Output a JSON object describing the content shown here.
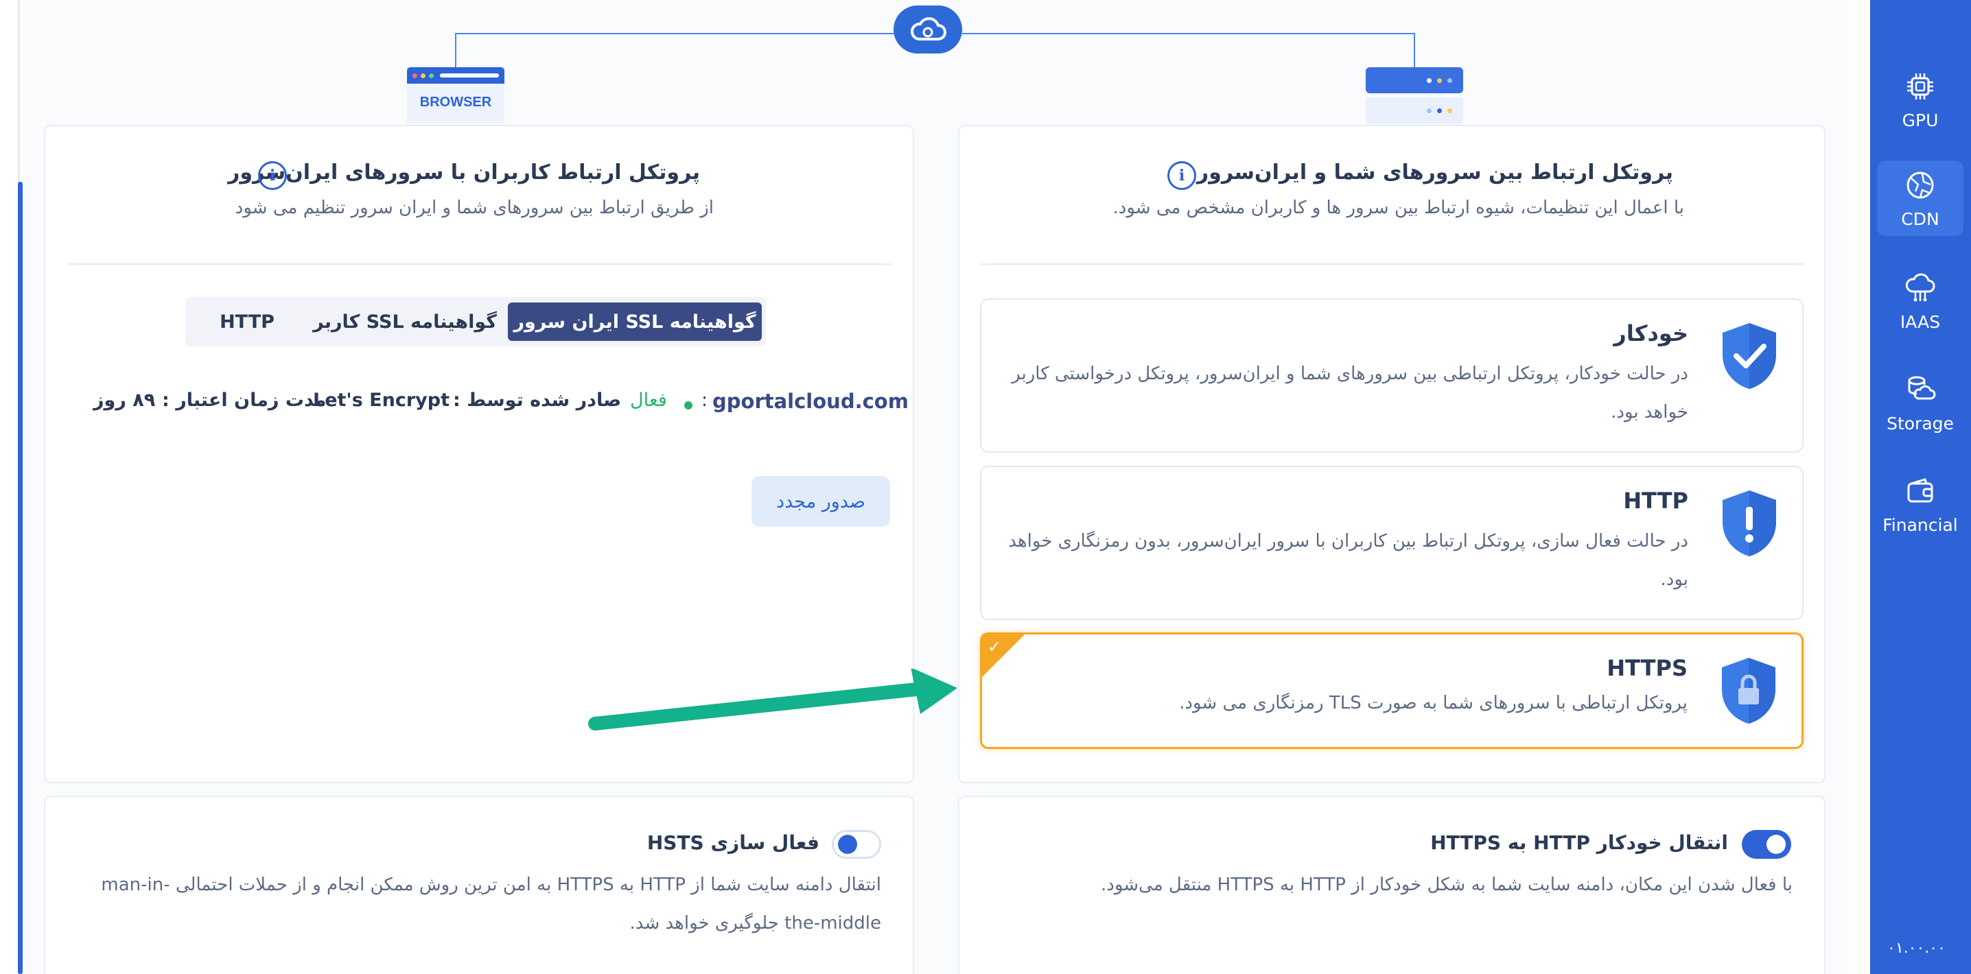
{
  "sidebar": {
    "items": [
      {
        "label": "GPU",
        "icon": "chip-icon"
      },
      {
        "label": "CDN",
        "icon": "globe-icon"
      },
      {
        "label": "IAAS",
        "icon": "cloud-network-icon"
      },
      {
        "label": "Storage",
        "icon": "storage-icon"
      },
      {
        "label": "Financial",
        "icon": "wallet-icon"
      }
    ],
    "active": "CDN",
    "version": "۰۱.۰۰.۰۰"
  },
  "diagram": {
    "browser_label": "BROWSER"
  },
  "user_protocol": {
    "title": "پروتکل ارتباط کاربران با سرورهای ایران‌سرور",
    "subtitle": "از طریق ارتباط بین سرورهای شما و ایران سرور تنظیم می شود",
    "tabs": [
      "گواهینامه SSL ایران سرور",
      "گواهینامه SSL کاربر",
      "HTTP"
    ],
    "active_tab": "گواهینامه SSL ایران سرور",
    "domain": "gportalcloud.com",
    "domain_sep": ":",
    "status": "فعال",
    "issuer_label": "صادر شده توسط :",
    "issuer": "Let's Encrypt",
    "validity_label": "مدت زمان اعتبار :",
    "validity": "۸۹ روز",
    "renew_button": "صدور مجدد"
  },
  "server_protocol": {
    "title": "پروتکل ارتباط بین سرورهای شما و ایران‌سرور",
    "subtitle": "با اعمال این تنظیمات، شیوه ارتباط بین سرور ها و کاربران مشخص می شود.",
    "options": [
      {
        "title": "خودکار",
        "desc": "در حالت خودکار، پروتکل ارتباطی بین سرورهای شما و ایران‌سرور، پروتکل درخواستی کاربر خواهد بود.",
        "icon": "shield-check-icon",
        "selected": false
      },
      {
        "title": "HTTP",
        "desc": "در حالت فعال سازی، پروتکل ارتباط بین کاربران با سرور ایران‌سرور، بدون رمزنگاری خواهد بود.",
        "icon": "shield-alert-icon",
        "selected": false
      },
      {
        "title": "HTTPS",
        "desc": "پروتکل ارتباطی با سرورهای شما به صورت TLS رمزنگاری می شود.",
        "icon": "shield-lock-icon",
        "selected": true
      }
    ]
  },
  "hsts": {
    "title": "فعال سازی HSTS",
    "desc": "انتقال دامنه سایت شما از HTTP به HTTPS به امن ترین روش ممکن انجام و از حملات احتمالی man-in-the-middle جلوگیری خواهد شد.",
    "enabled": false
  },
  "redirect": {
    "title": "انتقال خودکار HTTP به HTTPS",
    "desc": "با فعال شدن این مکان، دامنه سایت شما به شکل خودکار از HTTP به HTTPS منتقل می‌شود.",
    "enabled": true
  },
  "colors": {
    "primary": "#2d63d6",
    "selected_border": "#f5a623",
    "status_active": "#27b36a",
    "arrow": "#13b18c"
  }
}
